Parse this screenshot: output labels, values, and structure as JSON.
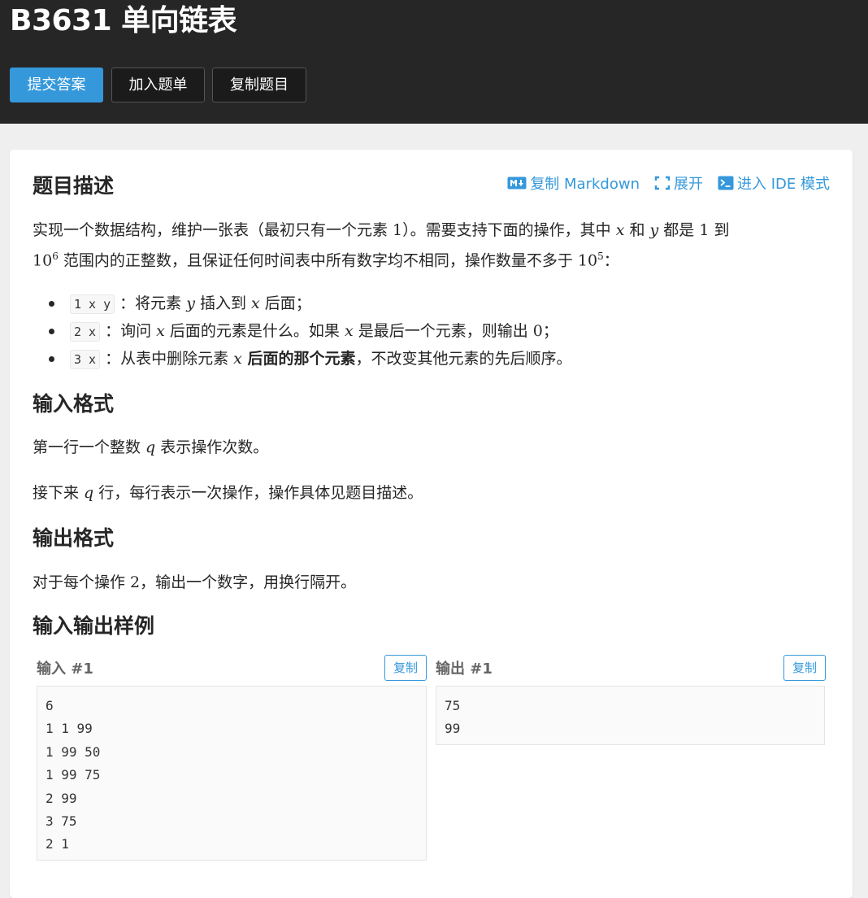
{
  "problem": {
    "title": "B3631 单向链表"
  },
  "header_buttons": {
    "submit": "提交答案",
    "add_to_list": "加入题单",
    "copy_problem": "复制题目"
  },
  "tools": {
    "copy_markdown": "复制 Markdown",
    "expand": "展开",
    "ide_mode": "进入 IDE 模式"
  },
  "sections": {
    "description": "题目描述",
    "input_format": "输入格式",
    "output_format": "输出格式",
    "samples": "输入输出样例"
  },
  "description": {
    "line1_a": "实现一个数据结构，维护一张表（最初只有一个元素 ",
    "line1_num": "1",
    "line1_b": "）。需要支持下面的操作，其中 ",
    "var_x": "x",
    "and": " 和 ",
    "var_y": "y",
    "line1_c": " 都是 ",
    "one": "1",
    "line1_d": " 到",
    "ten": "10",
    "exp6": "6",
    "line2_a": " 范围内的正整数，且保证任何时间表中所有数字均不相同，操作数量不多于 ",
    "exp5": "5",
    "line2_b": "："
  },
  "ops": [
    {
      "code": "1 x y",
      "pre": "：将元素 ",
      "v1": "y",
      "mid": " 插入到 ",
      "v2": "x",
      "post": " 后面；"
    },
    {
      "code": "2 x",
      "pre": "：询问 ",
      "v1": "x",
      "mid": " 后面的元素是什么。如果 ",
      "v2": "x",
      "post": " 是最后一个元素，则输出 ",
      "zero": "0",
      "end": "；"
    },
    {
      "code": "3 x",
      "pre": "：从表中删除元素 ",
      "v1": "x",
      "bold": " 后面的那个元素",
      "post": "，不改变其他元素的先后顺序。"
    }
  ],
  "input_format": {
    "p1_a": "第一行一个整数 ",
    "q": "q",
    "p1_b": " 表示操作次数。",
    "p2_a": "接下来 ",
    "p2_b": " 行，每行表示一次操作，操作具体见题目描述。"
  },
  "output_format": {
    "a": "对于每个操作 ",
    "two": "2",
    "b": "，输出一个数字，用换行隔开。"
  },
  "samples": {
    "input_label": "输入 #1",
    "output_label": "输出 #1",
    "copy": "复制",
    "input": "6\n1 1 99\n1 99 50\n1 99 75\n2 99\n3 75\n2 1",
    "output": "75\n99"
  }
}
